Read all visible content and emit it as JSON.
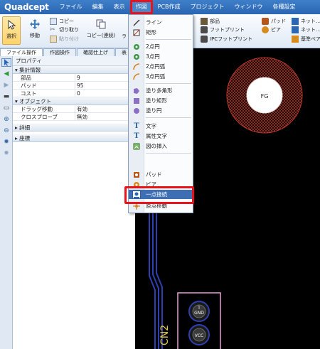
{
  "app": {
    "logo": "Quadcept"
  },
  "menubar": {
    "items": [
      {
        "label": "ファイル"
      },
      {
        "label": "編集"
      },
      {
        "label": "表示"
      },
      {
        "label": "作図",
        "active": true
      },
      {
        "label": "PCB作成"
      },
      {
        "label": "プロジェクト"
      },
      {
        "label": "ウィンドウ"
      },
      {
        "label": "各種設定"
      }
    ]
  },
  "ribbon": {
    "select": "選択",
    "move": "移動",
    "copy": "コピー",
    "cut": "切り取り",
    "paste": "貼り付け",
    "copy_continuous": "コピー(連続)",
    "ra": "ラ",
    "parts": "部品",
    "footprint": "フットプリント",
    "ipc_footprint": "IPCフットプリント",
    "pad": "パッド",
    "via": "ビア",
    "net1": "ネット…",
    "net2": "ネット…",
    "origin_move": "基準ペア…"
  },
  "tabs": [
    {
      "label": "ファイル操作"
    },
    {
      "label": "作図操作"
    },
    {
      "label": "確認仕上げ"
    },
    {
      "label": "表"
    }
  ],
  "panel": {
    "title": "プロパティ",
    "sections": {
      "summary": "集計情報",
      "object": "オブジェクト",
      "detail": "詳細",
      "coords": "座標"
    },
    "summary_rows": [
      {
        "key": "部品",
        "value": "9"
      },
      {
        "key": "パッド",
        "value": "95"
      },
      {
        "key": "コスト",
        "value": "0"
      }
    ],
    "object_rows": [
      {
        "key": "ドラッグ移動",
        "value": "有効"
      },
      {
        "key": "クロスプローブ",
        "value": "無効"
      }
    ]
  },
  "dropdown": {
    "items": [
      {
        "label": "ライン"
      },
      {
        "label": "矩形"
      },
      {
        "label": "2点円"
      },
      {
        "label": "3点円"
      },
      {
        "label": "2点円弧"
      },
      {
        "label": "3点円弧"
      },
      {
        "label": "塗り多角形"
      },
      {
        "label": "塗り矩形"
      },
      {
        "label": "塗り円"
      },
      {
        "label": "文字"
      },
      {
        "label": "属性文字"
      },
      {
        "label": "図の挿入"
      },
      {
        "label": "パッド"
      },
      {
        "label": "ビア"
      },
      {
        "label": "一点接続"
      },
      {
        "label": "原点移動"
      }
    ]
  },
  "canvas": {
    "fg_label": "FG",
    "gnd_label": "GND",
    "vcc_label": "VCC",
    "ref_label": "CN2",
    "pad_number": "1"
  },
  "colors": {
    "menubar": "#2a66b3",
    "highlight": "#e8141b",
    "pad_ring": "#c0392b",
    "outline": "#e6a0d8"
  }
}
